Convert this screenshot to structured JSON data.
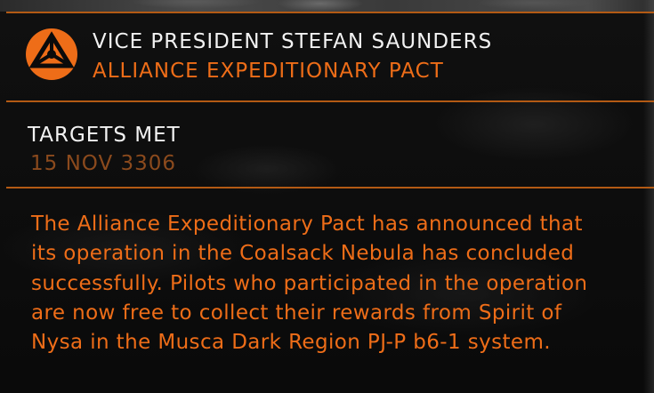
{
  "header": {
    "sender_name": "VICE PRESIDENT STEFAN SAUNDERS",
    "faction_name": "ALLIANCE EXPEDITIONARY PACT",
    "faction_icon": "alliance-emblem-icon"
  },
  "article": {
    "headline": "TARGETS MET",
    "date": "15 NOV 3306",
    "lines": [
      "The Alliance Expeditionary Pact has announced that",
      "its operation in the Coalsack Nebula has concluded",
      "successfully. Pilots who participated in the operation",
      "are now free to collect their rewards from Spirit of",
      "Nysa in the Musca Dark Region PJ-P b6-1 system."
    ]
  },
  "colors": {
    "accent": "#ee6d18",
    "divider": "#b35a14",
    "date": "#8b4a1d",
    "heading": "#f2f2f2",
    "background": "#0b0b0b"
  }
}
